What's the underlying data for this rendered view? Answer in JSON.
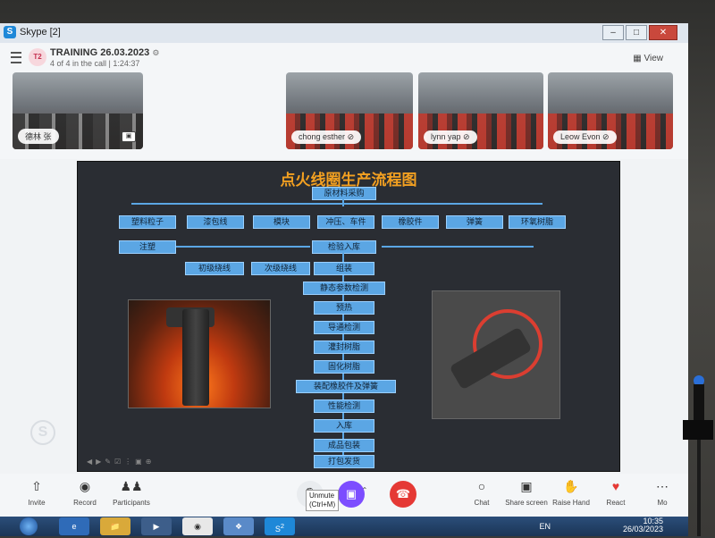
{
  "window": {
    "title": "Skype [2]"
  },
  "call": {
    "avatar": "T2",
    "name": "TRAINING 26.03.2023",
    "gear": "⚙",
    "status": "4 of 4 in the call | 1:24:37",
    "view_label": "View"
  },
  "participants": [
    {
      "name": "德林 张"
    },
    {
      "name": "chong esther"
    },
    {
      "name": "lynn yap"
    },
    {
      "name": "Leow Evon"
    }
  ],
  "slide": {
    "title": "点火线圈生产流程图",
    "top_box": "原材料采购",
    "materials": [
      "塑料粒子",
      "漆包线",
      "模块",
      "冲压、车件",
      "橡胶件",
      "弹簧",
      "环氧树脂"
    ],
    "inject": "注塑",
    "inspect": "检验入库",
    "primary": "初级绕线",
    "secondary": "次级绕线",
    "steps": [
      "组装",
      "静态参数检测",
      "预热",
      "导通检测",
      "灌封树脂",
      "固化树脂",
      "装配橡胶件及弹簧",
      "性能检测",
      "入库",
      "成品包装",
      "打包发货"
    ]
  },
  "controls": {
    "invite": "Invite",
    "record": "Record",
    "participants": "Participants",
    "chat": "Chat",
    "share": "Share screen",
    "raise": "Raise Hand",
    "react": "React",
    "more": "Mo",
    "tooltip_line1": "Unmute",
    "tooltip_line2": "(Ctrl+M)"
  },
  "taskbar": {
    "lang": "EN",
    "time": "10:35",
    "date": "26/03/2023",
    "skype_badge": "2"
  }
}
